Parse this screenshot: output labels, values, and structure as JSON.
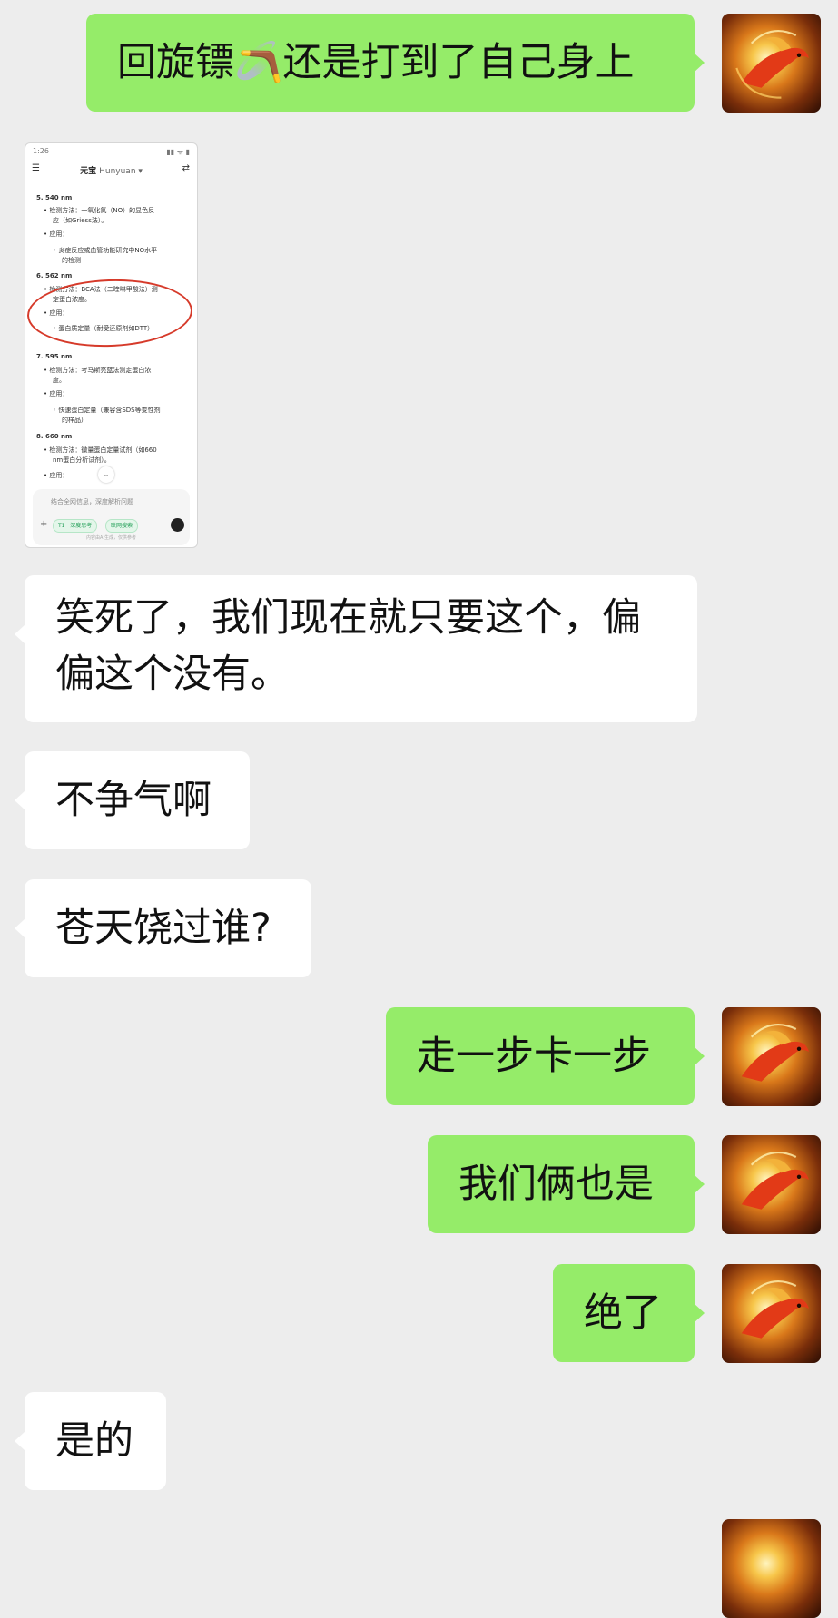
{
  "messages": {
    "m1": "回旋镖🪃还是打到了自己身上",
    "m2": "笑死了，我们现在就只要这个，偏偏这个没有。",
    "m3": "不争气啊",
    "m4": "苍天饶过谁?",
    "m5": "走一步卡一步",
    "m6": "我们俩也是",
    "m7": "绝了",
    "m8": "是的"
  },
  "screenshot": {
    "time": "1:26",
    "title": "元宝",
    "subtitle": "Hunyuan ▾",
    "lines": [
      "5. 540 nm",
      "• 检测方法：一氧化氮（NO）的显色反",
      "应（如Griess法）。",
      "• 应用：",
      "◦ 炎症反应或血管功能研究中NO水平",
      "的检测",
      "6. 562 nm",
      "• 检测方法：BCA法（二喹啉甲酸法）测",
      "定蛋白浓度。",
      "• 应用：",
      "◦ 蛋白质定量（耐受还原剂如DTT）",
      "7. 595 nm",
      "• 检测方法：考马斯亮蓝法测定蛋白浓",
      "度。",
      "• 应用：",
      "◦ 快速蛋白定量（兼容含SDS等变性剂",
      "的样品）",
      "8. 660 nm",
      "• 检测方法：微量蛋白定量试剂（如660",
      "nm蛋白分析试剂）。",
      "• 应用："
    ],
    "input_placeholder": "结合全网信息，深度解析问题",
    "chip1": "T1 · 深度思考",
    "chip2": "联网搜索",
    "footer": "内容由AI生成，仅供参考"
  },
  "colors": {
    "background": "#ededed",
    "my_bubble": "#95ec69",
    "other_bubble": "#ffffff",
    "annotation_circle": "#d63a2a"
  }
}
